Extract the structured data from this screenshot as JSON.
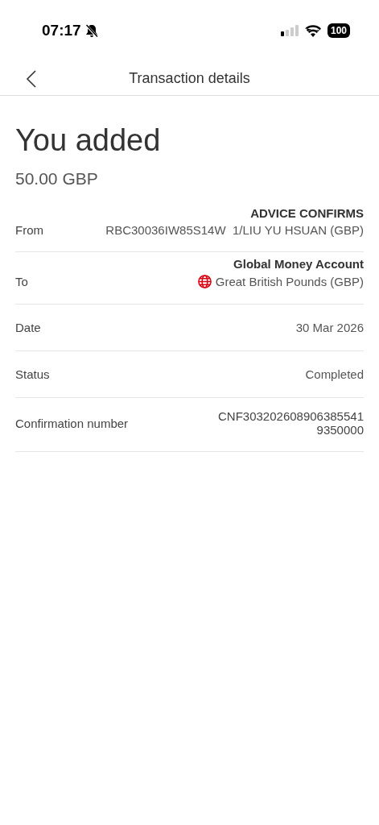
{
  "status_bar": {
    "time": "07:17",
    "silent": true,
    "battery": "100"
  },
  "header": {
    "title": "Transaction details"
  },
  "summary": {
    "heading": "You added",
    "amount": "50.00 GBP"
  },
  "rows": [
    {
      "kind": "plain",
      "label": "From",
      "title": "ADVICE CONFIRMS",
      "value_lines": [
        "RBC30036IW85S14W  1/LIU YU HSUAN (GBP)"
      ]
    },
    {
      "kind": "currency",
      "label": "To",
      "title": "Global Money Account",
      "value_lines": [
        "Great British Pounds (GBP)"
      ]
    },
    {
      "kind": "plain",
      "label": "Date",
      "value_lines": [
        "30 Mar 2026"
      ]
    },
    {
      "kind": "plain",
      "label": "Status",
      "value_lines": [
        "Completed"
      ]
    },
    {
      "kind": "plain",
      "label": "Confirmation number",
      "value_lines": [
        "CNF303202608906385541",
        "9350000"
      ]
    }
  ]
}
